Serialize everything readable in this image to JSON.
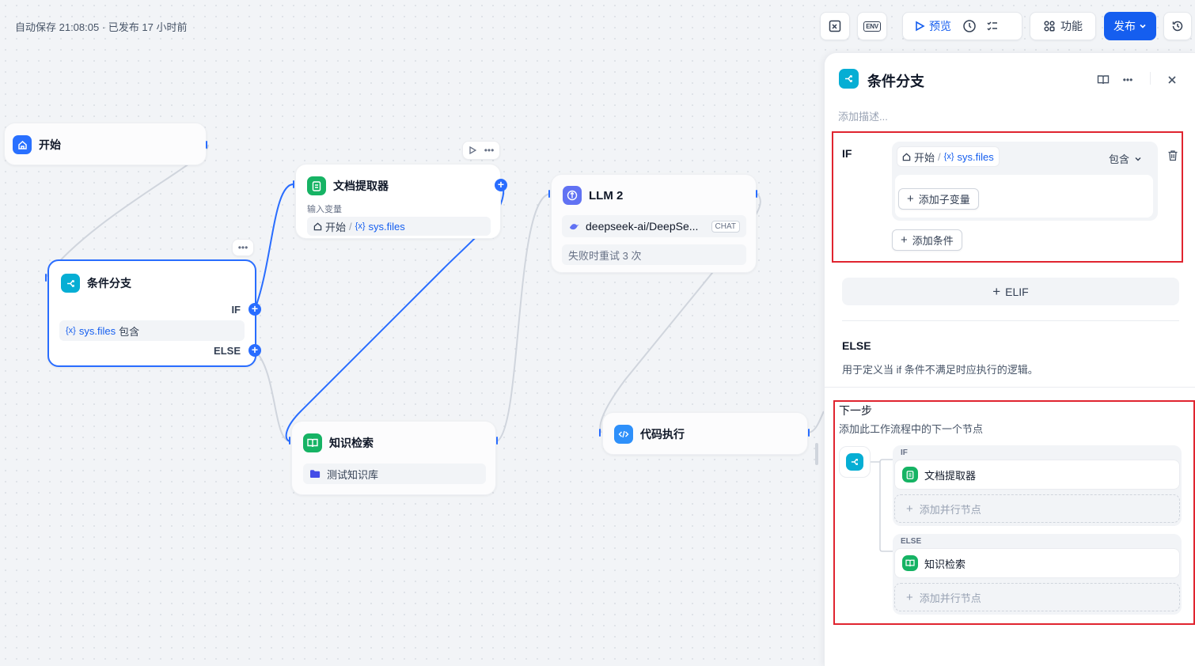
{
  "header": {
    "autosave_text": "自动保存 21:08:05 · 已发布 17 小时前",
    "preview_label": "预览",
    "features_label": "功能",
    "publish_label": "发布",
    "env_label": "ENV"
  },
  "nodes": {
    "start": {
      "title": "开始"
    },
    "if_else": {
      "title": "条件分支",
      "if_label": "IF",
      "else_label": "ELSE",
      "condition_var": "sys.files",
      "condition_op": "包含",
      "var_prefix": "{x}"
    },
    "doc_extractor": {
      "title": "文档提取器",
      "input_label": "输入变量",
      "source_node": "开始",
      "separator": "/",
      "var_prefix": "{x}",
      "var": "sys.files"
    },
    "llm": {
      "title": "LLM 2",
      "model": "deepseek-ai/DeepSe...",
      "mode_badge": "CHAT",
      "retry_text": "失败时重试 3 次"
    },
    "knowledge": {
      "title": "知识检索",
      "dataset": "测试知识库"
    },
    "code": {
      "title": "代码执行"
    }
  },
  "panel": {
    "title": "条件分支",
    "desc_placeholder": "添加描述...",
    "if_label": "IF",
    "cond_source": "开始",
    "separator": "/",
    "cond_var_prefix": "{x}",
    "cond_var": "sys.files",
    "cond_operator": "包含",
    "add_sub_var": "添加子变量",
    "add_condition": "添加条件",
    "elif_label": "ELIF",
    "else_label": "ELSE",
    "else_desc": "用于定义当 if 条件不满足时应执行的逻辑。",
    "next_step_title": "下一步",
    "next_step_desc": "添加此工作流程中的下一个节点",
    "branch_if": "IF",
    "branch_else": "ELSE",
    "if_target": "文档提取器",
    "else_target": "知识检索",
    "add_parallel_1": "添加并行节点",
    "add_parallel_2": "添加并行节点"
  },
  "colors": {
    "accent": "#155eef",
    "selected_border": "#296dff",
    "highlight_red": "#e0242f"
  }
}
